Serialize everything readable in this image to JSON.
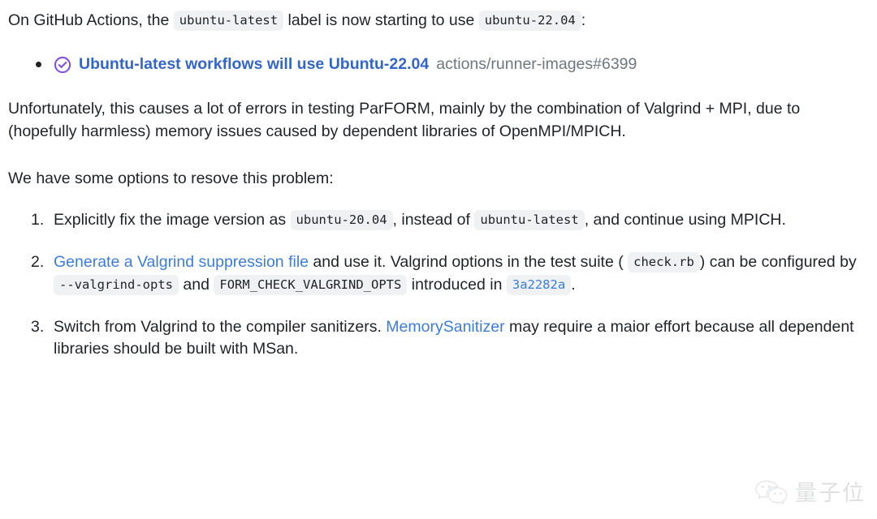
{
  "document": {
    "intro": {
      "before_code1": "On GitHub Actions, the",
      "code1": "ubuntu-latest",
      "between": "label is now starting to use",
      "code2": "ubuntu-22.04",
      "after": ":"
    },
    "issue_reference": {
      "icon": "issue-closed-completed-icon",
      "link_text": "Ubuntu-latest workflows will use Ubuntu-22.04",
      "reference": "actions/runner-images#6399"
    },
    "problem_paragraph": "Unfortunately, this causes a lot of errors in testing ParFORM, mainly by the combination of Valgrind + MPI, due to (hopefully harmless) memory issues caused by dependent libraries of OpenMPI/MPICH.",
    "options_heading": "We have some options to resove this problem:",
    "options": [
      {
        "number": "1.",
        "seg1": "Explicitly fix the image version as",
        "code1": "ubuntu-20.04",
        "seg2": ", instead of",
        "code2": "ubuntu-latest",
        "seg3": ", and continue using MPICH."
      },
      {
        "number": "2.",
        "link1": "Generate a Valgrind suppression file",
        "seg1": "and use it. Valgrind options in the test suite (",
        "code1": "check.rb",
        "seg2": ") can be configured by",
        "code2": "--valgrind-opts",
        "seg3": "and",
        "code3": "FORM_CHECK_VALGRIND_OPTS",
        "seg4": "introduced in",
        "code4": "3a2282a",
        "seg5": "."
      },
      {
        "number": "3.",
        "seg1": "Switch from Valgrind to the compiler sanitizers.",
        "link1": "MemorySanitizer",
        "seg2": "may require a maior effort because all dependent libraries should be built with MSan."
      }
    ]
  },
  "watermark": {
    "icon": "wechat-logo-icon",
    "text": "量子位"
  },
  "colors": {
    "link_blue": "#3b7ddd",
    "link_blue_bold": "#3366cc",
    "issue_purple": "#8250df",
    "code_bg": "#eff1f3",
    "text": "#1f2328",
    "muted": "#6e7781"
  }
}
